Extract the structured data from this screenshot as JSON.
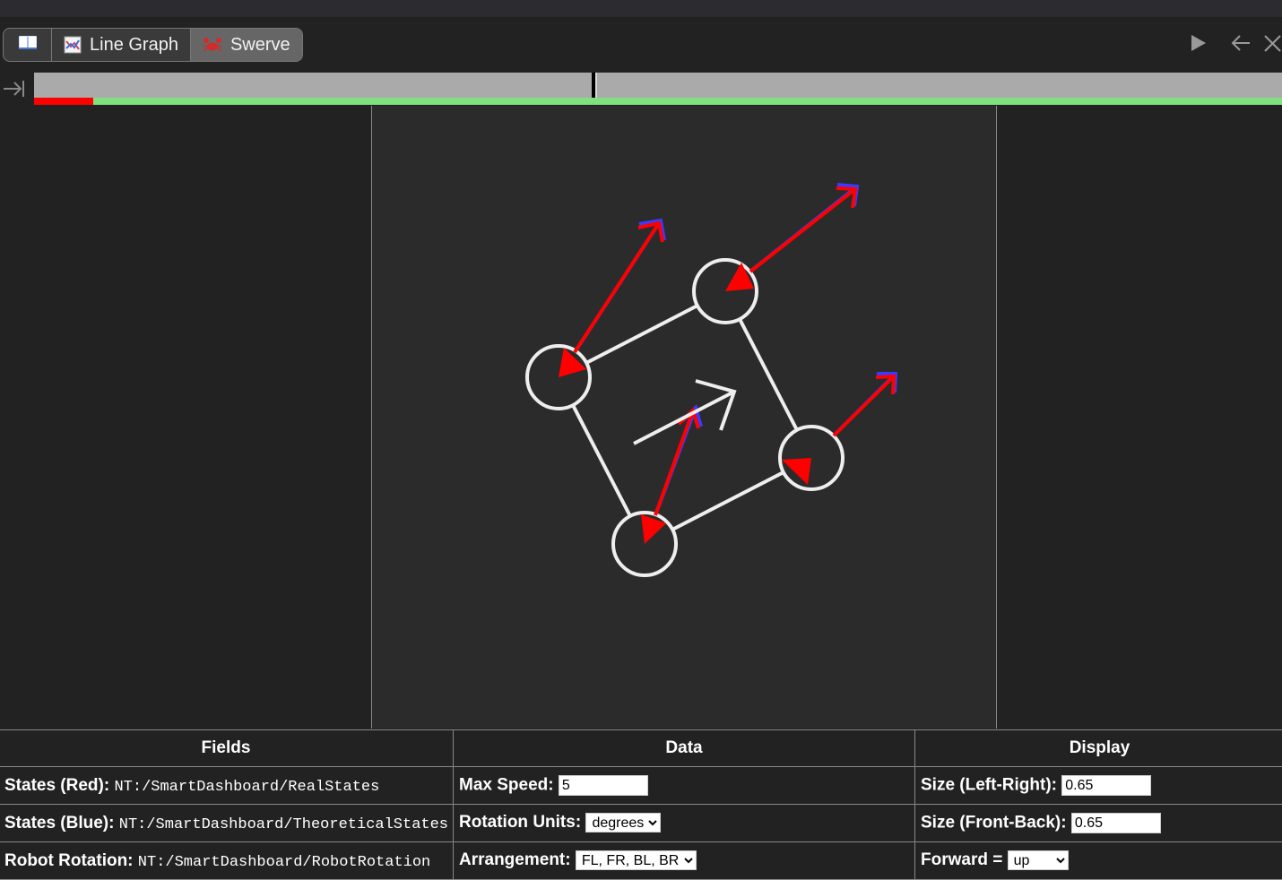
{
  "tabs": [
    {
      "label": "",
      "icon": "book-icon",
      "selected": false
    },
    {
      "label": "Line Graph",
      "icon": "line-graph-icon",
      "selected": false
    },
    {
      "label": "Swerve",
      "icon": "crab-icon",
      "selected": true
    }
  ],
  "window_controls": [
    "play-icon",
    "back-arrow-icon",
    "close-icon"
  ],
  "timeline": {
    "cursor_fraction": 0.449,
    "loaded_fraction": 0.047
  },
  "colors": {
    "real": "#ff0000",
    "theoretical": "#3b3bff",
    "robot": "#eeeeee",
    "loaded": "#80e080",
    "canvas": "#2b2b2b"
  },
  "table": {
    "headers": {
      "fields": "Fields",
      "data": "Data",
      "display": "Display"
    },
    "rows": [
      {
        "field_label": "States (Red):",
        "field_value": "NT:/SmartDashboard/RealStates",
        "data_label": "Max Speed:",
        "data_value": "5",
        "display_label": "Size (Left-Right):",
        "display_value": "0.65"
      },
      {
        "field_label": "States (Blue):",
        "field_value": "NT:/SmartDashboard/TheoreticalStates",
        "data_label": "Rotation Units:",
        "data_value": "degrees",
        "display_label": "Size (Front-Back):",
        "display_value": "0.65"
      },
      {
        "field_label": "Robot Rotation:",
        "field_value": "NT:/SmartDashboard/RobotRotation",
        "data_label": "Arrangement:",
        "data_value": "FL, FR, BL, BR",
        "display_label": "Forward =",
        "display_value": "up"
      }
    ]
  }
}
